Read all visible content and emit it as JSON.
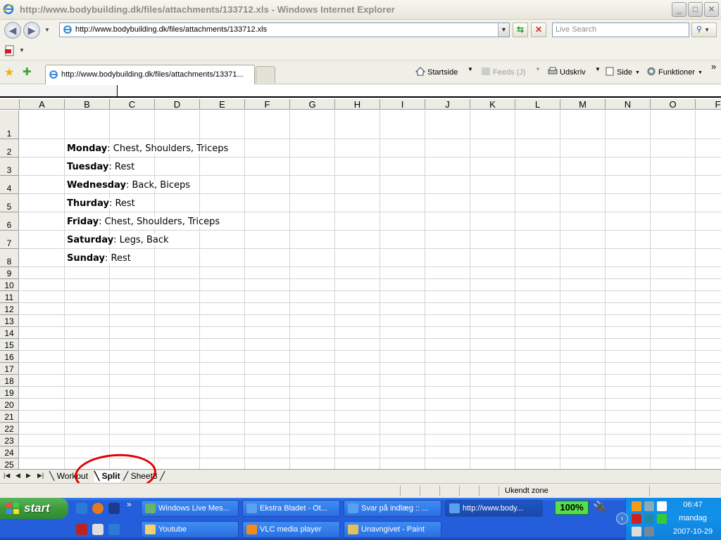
{
  "window": {
    "title": "http://www.bodybuilding.dk/files/attachments/133712.xls - Windows Internet Explorer",
    "min": "_",
    "max": "□",
    "close": "✕"
  },
  "address": {
    "url": "http://www.bodybuilding.dk/files/attachments/133712.xls",
    "search_placeholder": "Live Search"
  },
  "tabs": {
    "active_label": "http://www.bodybuilding.dk/files/attachments/13371..."
  },
  "commands": {
    "home": "Startside",
    "feeds": "Feeds (J)",
    "print": "Udskriv",
    "page": "Side",
    "tools": "Funktioner",
    "more": "»"
  },
  "sheet": {
    "columns": [
      "A",
      "B",
      "C",
      "D",
      "E",
      "F",
      "G",
      "H",
      "I",
      "J",
      "K",
      "L",
      "M",
      "N",
      "O",
      "F"
    ],
    "rows": [
      "1",
      "2",
      "3",
      "4",
      "5",
      "6",
      "7",
      "8",
      "9",
      "10",
      "11",
      "12",
      "13",
      "14",
      "15",
      "16",
      "17",
      "18",
      "19",
      "20",
      "21",
      "22",
      "23",
      "24",
      "25"
    ],
    "schedule": [
      {
        "day": "Monday",
        "rest": ": Chest, Shoulders, Triceps"
      },
      {
        "day": "Tuesday",
        "rest": ": Rest"
      },
      {
        "day": "Wednesday",
        "rest": ": Back, Biceps"
      },
      {
        "day": "Thurday",
        "rest": ": Rest"
      },
      {
        "day": "Friday",
        "rest": ": Chest, Shoulders, Triceps"
      },
      {
        "day": "Saturday",
        "rest": ": Legs, Back"
      },
      {
        "day": "Sunday",
        "rest": ": Rest"
      }
    ],
    "sheet_tabs": [
      "Workout",
      "Split",
      "Sheet3"
    ],
    "active_sheet": "Split"
  },
  "status": {
    "zone": "Ukendt zone"
  },
  "taskbar": {
    "start": "start",
    "buttons_row1": [
      "Windows Live Mes...",
      "Ekstra Bladet - Ot...",
      "Svar på indlæg :: ...",
      "http://www.body..."
    ],
    "buttons_row2": [
      "Youtube",
      "VLC media player",
      "Unavngivet - Paint"
    ],
    "zoom": "100%",
    "time": "06:47",
    "day": "mandag",
    "date": "2007-10-29"
  },
  "colors": {
    "taskbar": "#245edb",
    "start_green": "#3c9b3c",
    "annotation_red": "#e00000"
  }
}
